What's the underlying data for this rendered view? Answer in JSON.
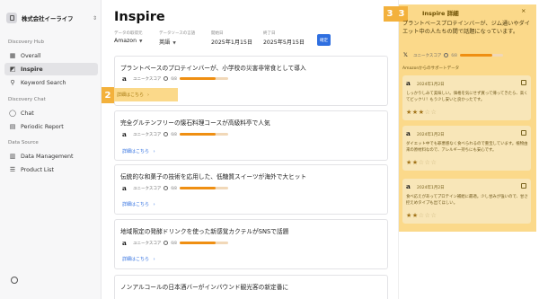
{
  "sidebar": {
    "company": "株式会社イーライフ",
    "sections": {
      "discovery_hub": "Discovery Hub",
      "discovery_chat": "Discovery Chat",
      "data_source": "Data Source"
    },
    "items": [
      {
        "label": "Overall",
        "icon": "grid-icon",
        "active": false
      },
      {
        "label": "Inspire",
        "icon": "chart-icon",
        "active": true
      },
      {
        "label": "Keyword Search",
        "icon": "search-icon",
        "active": false
      },
      {
        "label": "Chat",
        "icon": "chat-icon",
        "active": false
      },
      {
        "label": "Periodic Report",
        "icon": "report-icon",
        "active": false
      },
      {
        "label": "Data Management",
        "icon": "database-icon",
        "active": false
      },
      {
        "label": "Product List",
        "icon": "list-icon",
        "active": false
      }
    ]
  },
  "main": {
    "title": "Inspire",
    "filters": [
      {
        "label": "データの取得元",
        "value": "Amazon"
      },
      {
        "label": "データソースの言語",
        "value": "英語"
      },
      {
        "label": "開始日",
        "value": "2025年1月15日"
      },
      {
        "label": "終了日",
        "value": "2025年5月15日"
      }
    ],
    "confirm_label": "確定",
    "score_label": "ユニークスコア",
    "score_value": "6/8",
    "link_label": "詳細はこちら",
    "cards": [
      {
        "title": "プラントベースのプロテインバーが、小学校の災害非常食として導入",
        "score": 0.75
      },
      {
        "title": "完全グルテンフリーの懐石料理コースが高級料亭で人気",
        "score": 0.75
      },
      {
        "title": "伝統的な和菓子の技術を応用した、低糖質スイーツが海外で大ヒット",
        "score": 0.75
      },
      {
        "title": "地域限定の発酵ドリンクを使った新感覚カクテルがSNSで話題",
        "score": 0.75
      },
      {
        "title": "ノンアルコールの日本酒バーがインバウンド観光客の新定番に",
        "score": 0.75
      }
    ],
    "markers": {
      "link": "2",
      "panel": "3"
    }
  },
  "panel": {
    "title": "Inspire 詳細",
    "close": "×",
    "description": "プラントベースプロテインバーが、ジム通いやダイエット中の人たちの間で話題になっています。",
    "score_label": "ユニークスコア",
    "score_value": "6/8",
    "score": 0.75,
    "sub_label": "Amazonからのサポートデータ",
    "reviews": [
      {
        "date": "2024年1月2日",
        "text": "しっかりしみて美味しい。価格を気にせず買って帰ってきたら、高くてビックリ！もう少し安いと良かったです。",
        "rating": 3
      },
      {
        "date": "2024年1月2日",
        "text": "ダイエット中でも罪悪感なく食べられるので重宝しています。植物由来の原材料なので、アレルギー持ちにも安心です。",
        "rating": 2
      },
      {
        "date": "2024年1月2日",
        "text": "食べ応えがあってプロテイン補給に最適。少し甘みが強いので、甘さ控えめタイプも出てほしい。",
        "rating": 2
      }
    ]
  },
  "colors": {
    "accent": "#2f6fe0",
    "score_bar": "#ef8f12",
    "highlight": "#fbd98a",
    "marker": "#f3b13c"
  }
}
